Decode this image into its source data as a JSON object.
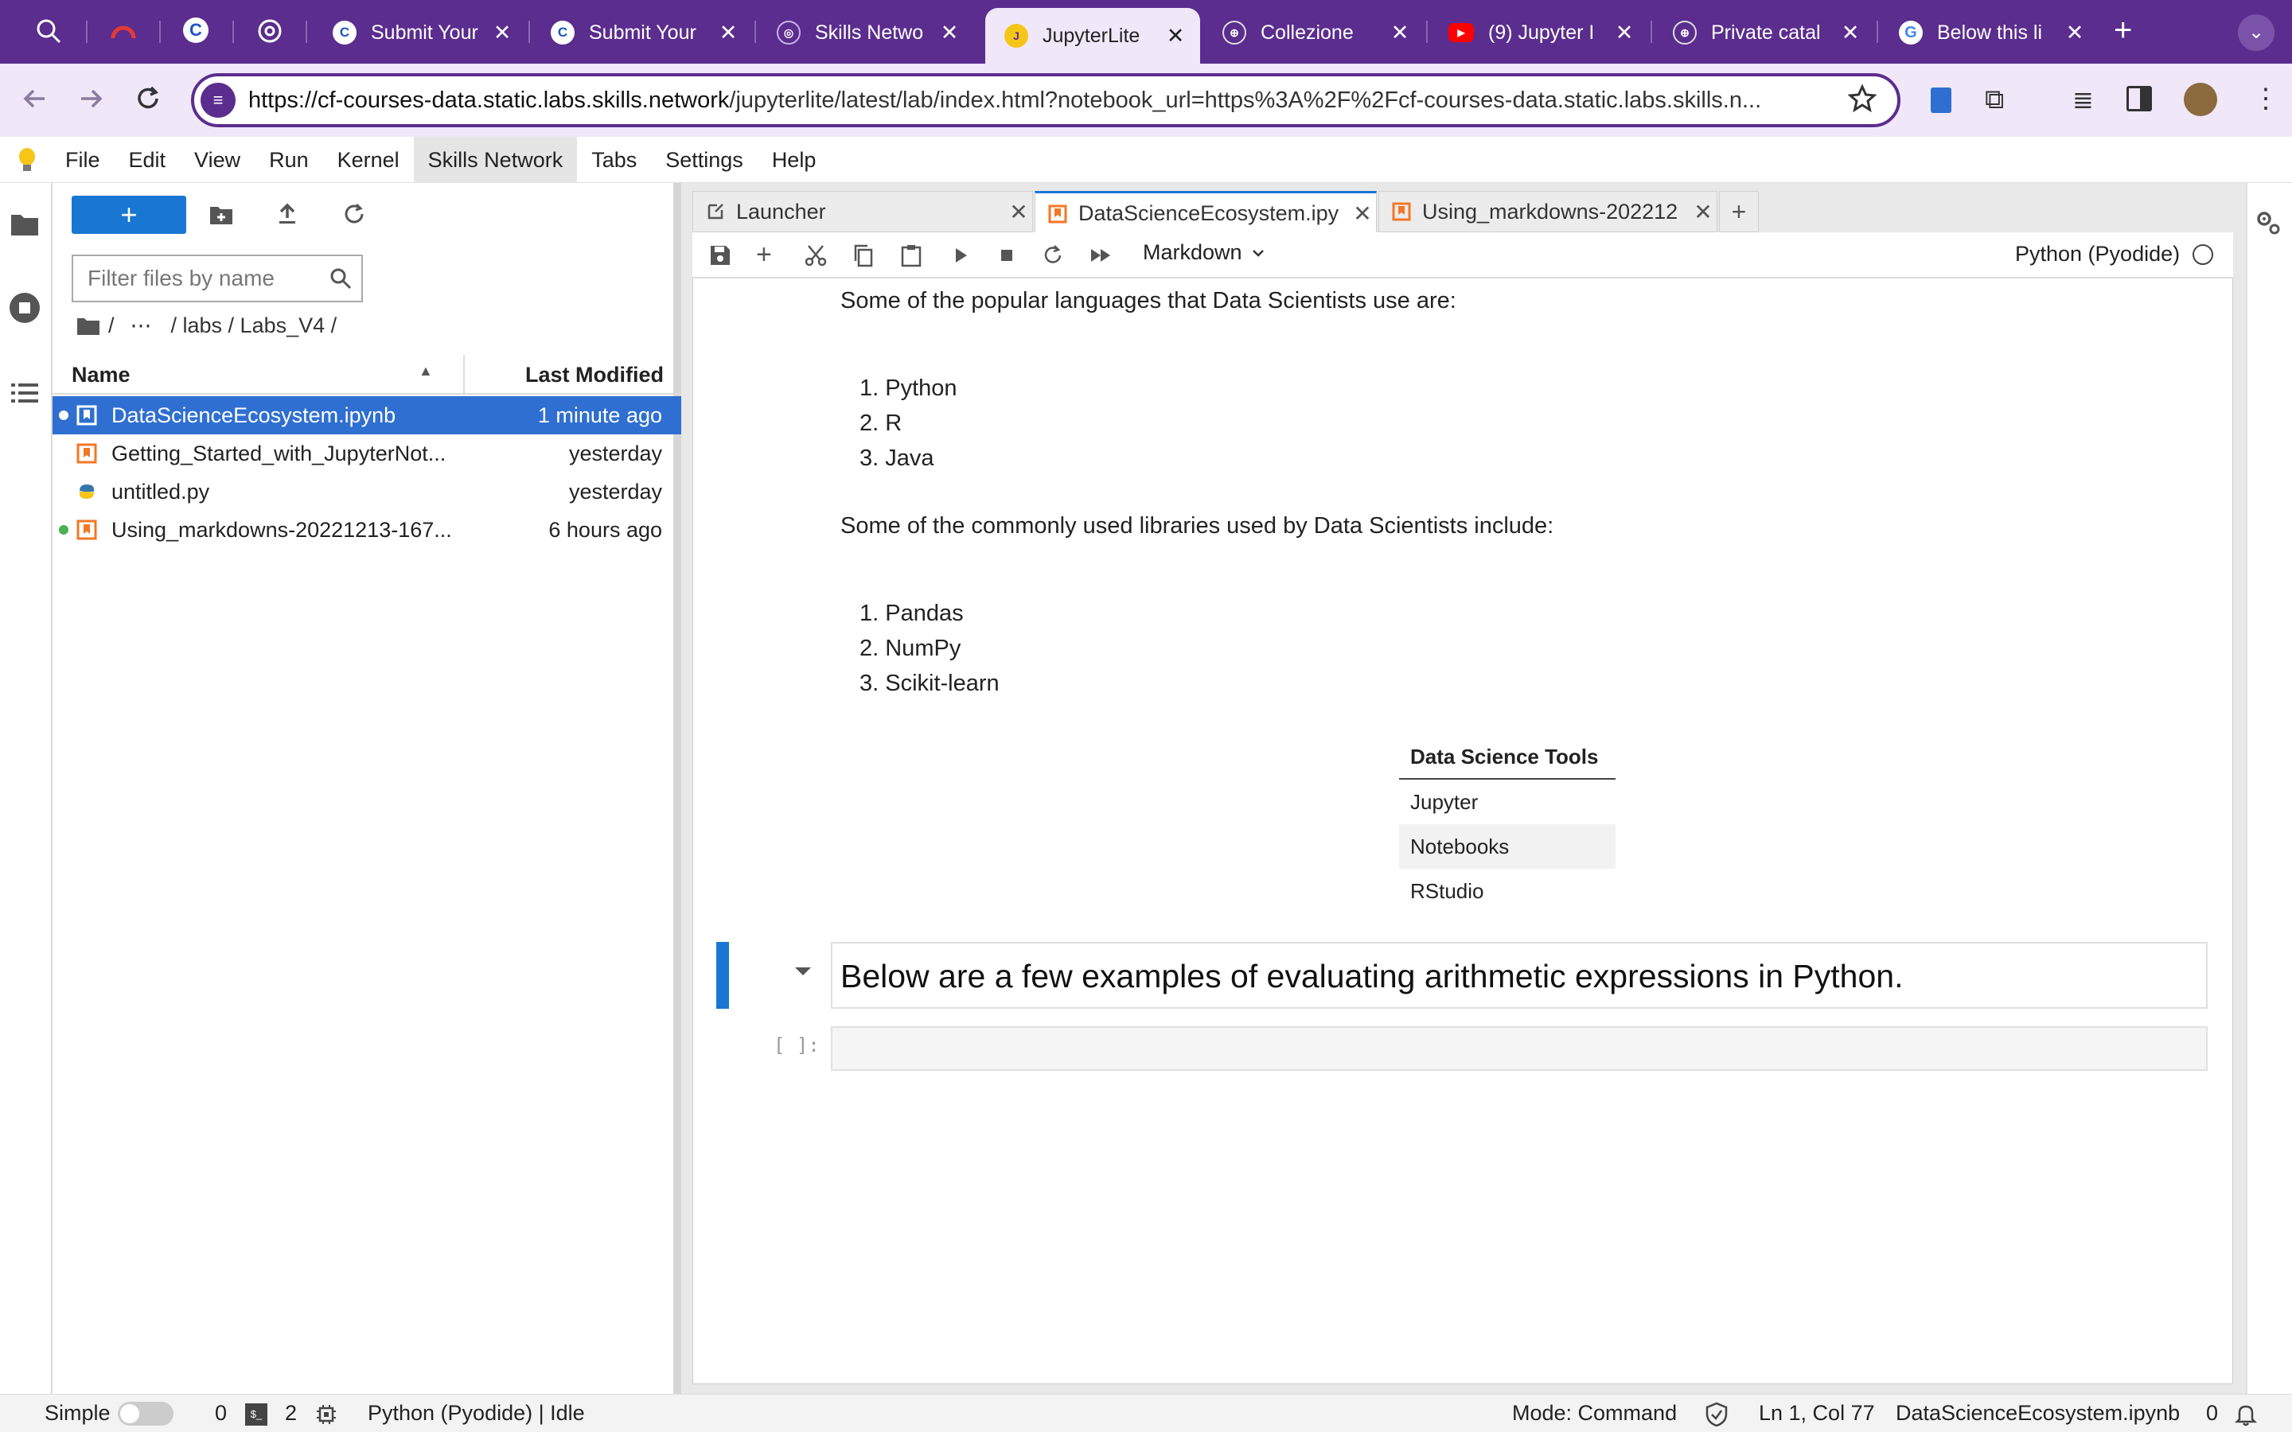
{
  "browser": {
    "tabs": [
      {
        "label": "",
        "icon": "magnifier-icon",
        "active": false
      },
      {
        "label": "",
        "icon": "arc-icon",
        "active": false
      },
      {
        "label": "",
        "icon": "c-icon",
        "active": false
      },
      {
        "label": "",
        "icon": "chatgpt-icon",
        "active": false
      },
      {
        "label": "Submit Your",
        "icon": "c-icon",
        "active": false
      },
      {
        "label": "Submit Your",
        "icon": "c-icon",
        "active": false
      },
      {
        "label": "Skills Netwo",
        "icon": "skills-icon",
        "active": false
      },
      {
        "label": "JupyterLite",
        "icon": "jupyterlite-icon",
        "active": true
      },
      {
        "label": "Collezione",
        "icon": "globe-icon",
        "active": false
      },
      {
        "label": "(9) Jupyter I",
        "icon": "youtube-icon",
        "active": false
      },
      {
        "label": "Private catal",
        "icon": "globe-icon",
        "active": false
      },
      {
        "label": "Below this li",
        "icon": "google-icon",
        "active": false
      }
    ],
    "url_host": "https://cf-courses-data.static.labs.skills.network",
    "url_path": "/jupyterlite/latest/lab/index.html?notebook_url=https%3A%2F%2Fcf-courses-data.static.labs.skills.n..."
  },
  "menubar": [
    "File",
    "Edit",
    "View",
    "Run",
    "Kernel",
    "Skills Network",
    "Tabs",
    "Settings",
    "Help"
  ],
  "filebrowser": {
    "new_label": "+",
    "filter_placeholder": "Filter files by name",
    "breadcrumb": [
      "/",
      "⋯",
      "/ labs / Labs_V4 /"
    ],
    "col_name": "Name",
    "col_modified": "Last Modified",
    "files": [
      {
        "name": "DataScienceEcosystem.ipynb",
        "modified": "1 minute ago",
        "selected": true,
        "running": true,
        "kind": "notebook"
      },
      {
        "name": "Getting_Started_with_JupyterNot...",
        "modified": "yesterday",
        "selected": false,
        "running": false,
        "kind": "notebook"
      },
      {
        "name": "untitled.py",
        "modified": "yesterday",
        "selected": false,
        "running": false,
        "kind": "python"
      },
      {
        "name": "Using_markdowns-20221213-167...",
        "modified": "6 hours ago",
        "selected": false,
        "running": true,
        "kind": "notebook"
      }
    ]
  },
  "doctabs": [
    {
      "label": "Launcher",
      "active": false
    },
    {
      "label": "DataScienceEcosystem.ipy",
      "active": true
    },
    {
      "label": "Using_markdowns-202212",
      "active": false
    }
  ],
  "notebook": {
    "cell_type": "Markdown",
    "kernel": "Python (Pyodide)",
    "intro_languages": "Some of the popular languages that Data Scientists use are:",
    "languages": [
      "1. Python",
      "2. R",
      "3. Java"
    ],
    "intro_libraries": "Some of the commonly used libraries used by Data Scientists include:",
    "libraries": [
      "1. Pandas",
      "2. NumPy",
      "3. Scikit-learn"
    ],
    "table_header": "Data Science Tools",
    "table_rows": [
      "Jupyter",
      "Notebooks",
      "RStudio"
    ],
    "heading": "Below are a few examples of evaluating arithmetic expressions in Python.",
    "prompt": "[ ]:"
  },
  "statusbar": {
    "mode_label": "Simple",
    "terminals": "0",
    "kernels": "2",
    "kernel_status": "Python (Pyodide) | Idle",
    "mode": "Mode: Command",
    "position": "Ln 1, Col 77",
    "filename": "DataScienceEcosystem.ipynb",
    "notifications": "0"
  },
  "colors": {
    "browser_purple": "#5b2d8e",
    "jupyter_blue": "#1976d2",
    "notebook_orange": "#f37726"
  }
}
